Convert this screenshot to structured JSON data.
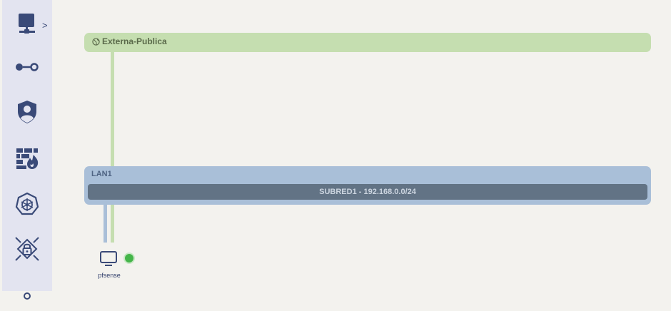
{
  "sidebar": {
    "items": [
      {
        "name": "server-network",
        "icon": "server-network-icon",
        "expand": ">"
      },
      {
        "name": "connection",
        "icon": "link-node-icon"
      },
      {
        "name": "user-shield",
        "icon": "user-shield-icon"
      },
      {
        "name": "firewall",
        "icon": "firewall-fire-icon"
      },
      {
        "name": "kubernetes",
        "icon": "kubernetes-wheel-icon"
      },
      {
        "name": "vpn-lock",
        "icon": "lock-network-icon"
      },
      {
        "name": "key",
        "icon": "key-icon"
      }
    ]
  },
  "networks": {
    "external": {
      "label": "Externa-Publica",
      "icon": "globe-icon",
      "color": "#c5deb0"
    },
    "lan": {
      "label": "LAN1",
      "color": "#a9bfd8",
      "subnet": {
        "label": "SUBRED1 - 192.168.0.0/24",
        "color": "#627385"
      }
    }
  },
  "nodes": [
    {
      "name": "pfsense",
      "icon": "monitor-icon",
      "status": "online",
      "status_color": "#44b549"
    }
  ]
}
